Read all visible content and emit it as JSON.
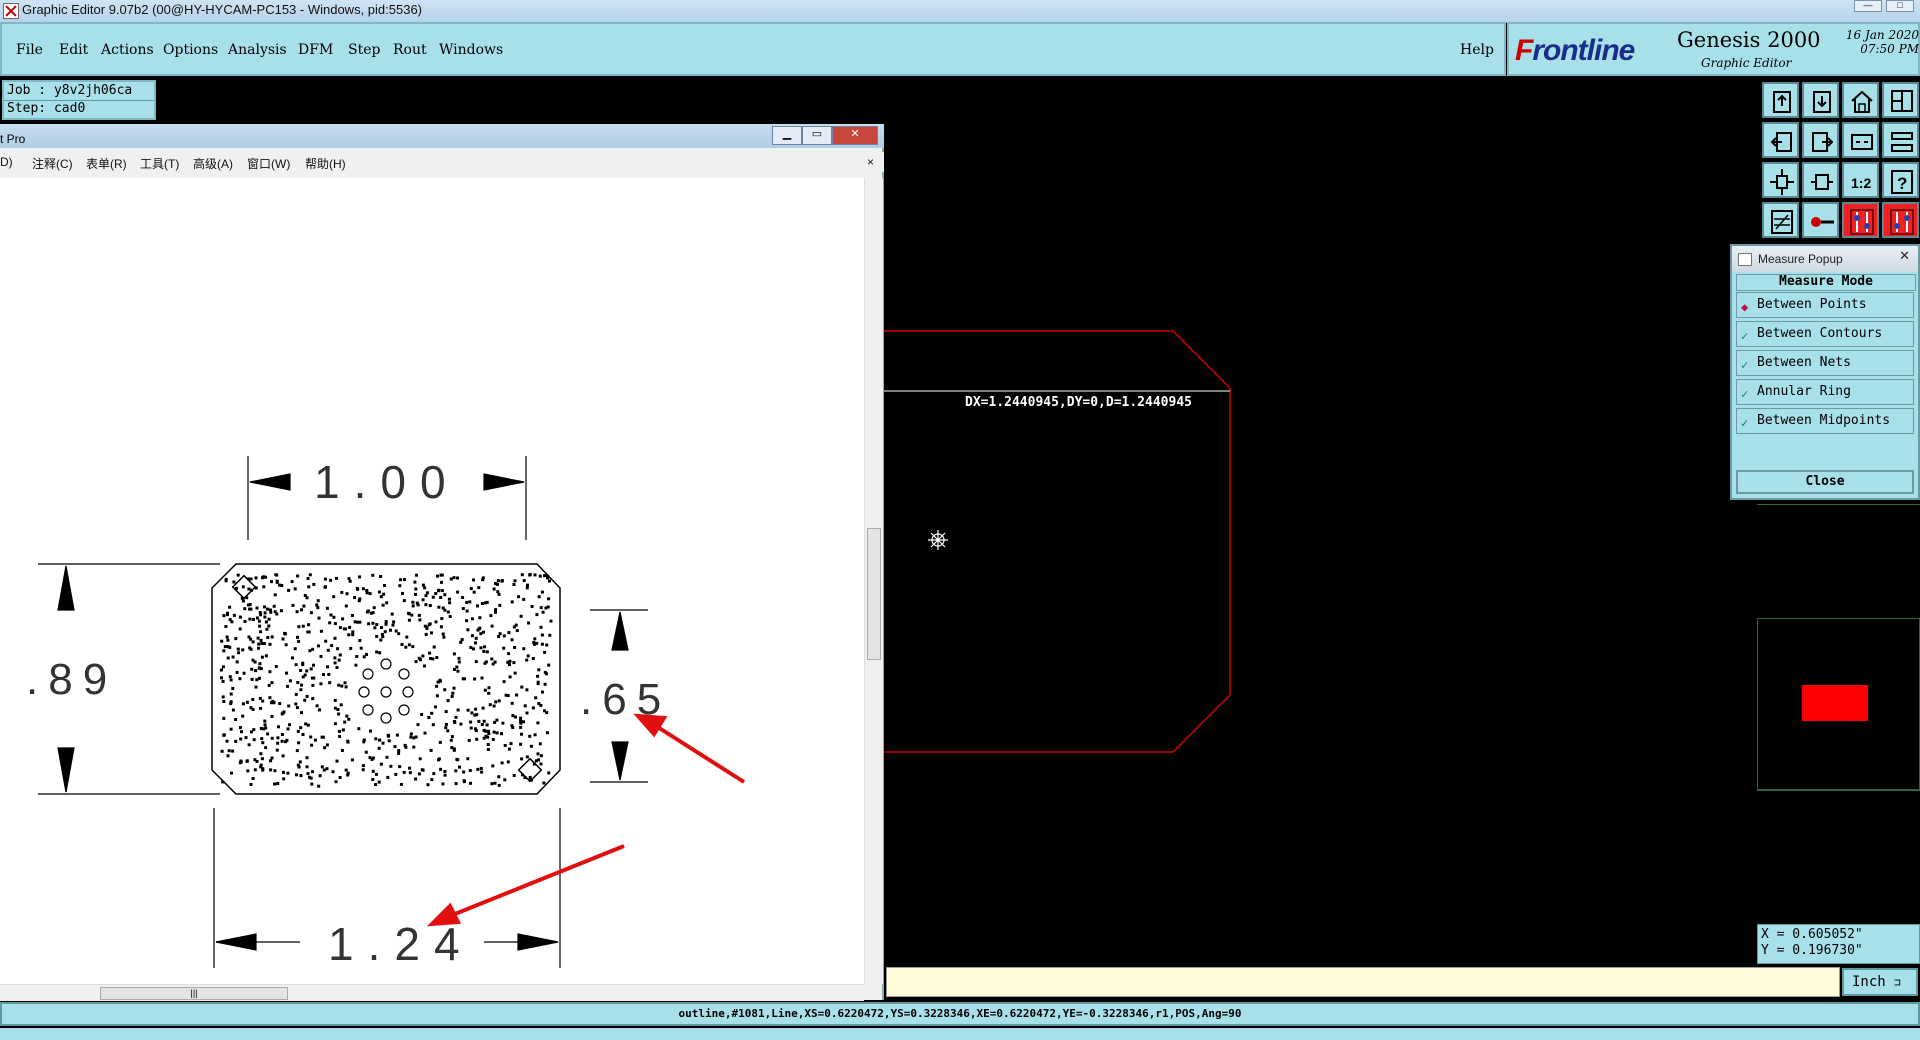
{
  "window": {
    "title": "Graphic Editor 9.07b2 (00@HY-HYCAM-PC153 - Windows, pid:5536)",
    "controls": [
      "—",
      "□"
    ]
  },
  "menubar": {
    "items": [
      "File",
      "Edit",
      "Actions",
      "Options",
      "Analysis",
      "DFM",
      "Step",
      "Rout",
      "Windows"
    ],
    "help": "Help"
  },
  "brand": {
    "logo_first": "F",
    "logo_rest": "rontline",
    "product": "Genesis 2000",
    "subtitle": "Graphic Editor",
    "date": "16 Jan 2020",
    "time": "07:50 PM"
  },
  "job": {
    "job_label": "Job : y8v2jh06ca",
    "step_label": "Step: cad0"
  },
  "pdf_viewer": {
    "title": "t Pro",
    "controls": [
      "▁",
      "▭",
      "✕"
    ],
    "menu": [
      "D)",
      "注释(C)",
      "表单(R)",
      "工具(T)",
      "高级(A)",
      "窗口(W)",
      "帮助(H)"
    ],
    "menu_close": "×",
    "hscroll_grip": "|||",
    "drawing": {
      "dim_top": "1.00",
      "dim_left": ".89",
      "dim_right": ".65",
      "dim_bottom": "1.24"
    }
  },
  "canvas": {
    "measure_readout": "DX=1.2440945,DY=0,D=1.2440945",
    "outline_color": "#cc0000"
  },
  "measure_popup": {
    "title": "Measure Popup",
    "close_x": "✕",
    "header": "Measure Mode",
    "options": [
      {
        "label": "Between Points",
        "selected": true
      },
      {
        "label": "Between Contours",
        "selected": false
      },
      {
        "label": "Between Nets",
        "selected": false
      },
      {
        "label": "Annular Ring",
        "selected": false
      },
      {
        "label": "Between Midpoints",
        "selected": false
      }
    ],
    "close_label": "Close"
  },
  "toolbar": {
    "icons": [
      "top-view-icon",
      "bottom-view-icon",
      "home-icon",
      "layout-icon",
      "pan-left-icon",
      "pan-right-icon",
      "zoom-area-icon",
      "split-icon",
      "fit-horizontal-icon",
      "fit-vertical-icon",
      "scale-1-2-icon",
      "help-icon",
      "snap-icon",
      "key-icon",
      "layers-red-icon",
      "layers-red-2-icon"
    ]
  },
  "coords": {
    "x": "X = 0.605052\"",
    "y": "Y = 0.196730\""
  },
  "units": {
    "label": "Inch"
  },
  "status": {
    "text": "outline,#1081,Line,XS=0.6220472,YS=0.3228346,XE=0.6220472,YE=-0.3228346,r1,POS,Ang=90"
  },
  "colors": {
    "panel": "#a8e0ea",
    "canvas": "#000000",
    "outline": "#cc0000",
    "cmd_strip": "#fffbd8"
  }
}
